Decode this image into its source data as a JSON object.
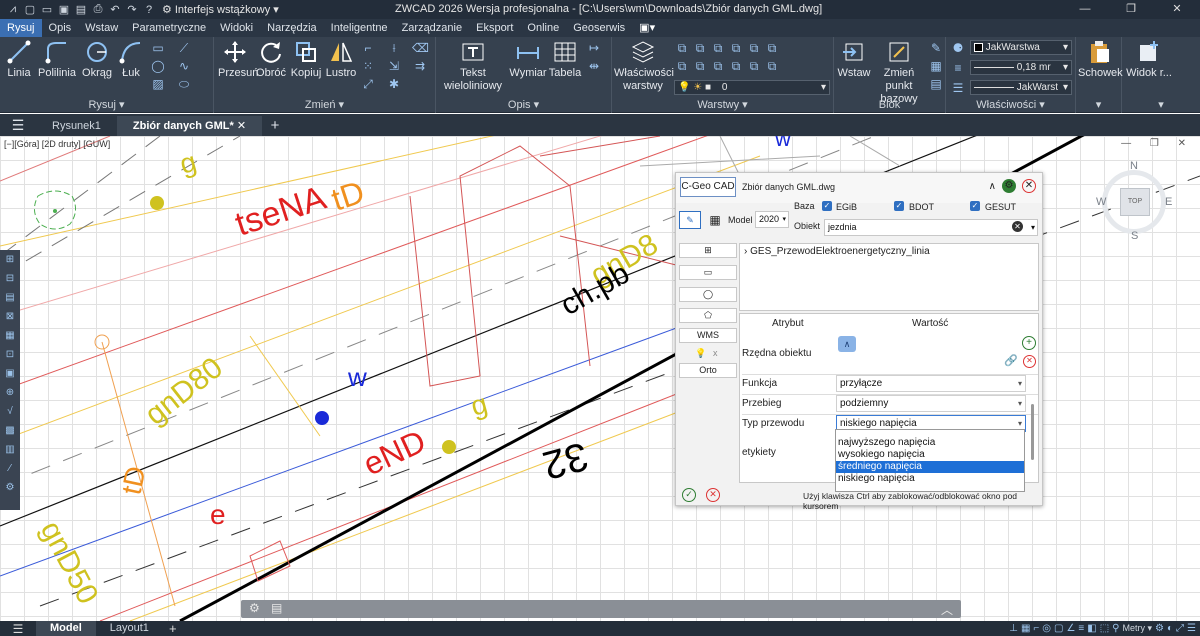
{
  "titlebar": {
    "workspace": "Interfejs wstążkowy",
    "title": "ZWCAD 2026 Wersja profesjonalna - [C:\\Users\\wm\\Downloads\\Zbiór danych GML.dwg]"
  },
  "menu": [
    "Rysuj",
    "Opis",
    "Wstaw",
    "Parametryczne",
    "Widoki",
    "Narzędzia",
    "Inteligentne",
    "Zarządzanie",
    "Eksport",
    "Online",
    "Geoserwis"
  ],
  "ribbon": {
    "rysuj": {
      "title": "Rysuj",
      "linia": "Linia",
      "polilinia": "Polilinia",
      "okrag": "Okrąg",
      "luk": "Łuk"
    },
    "zmien": {
      "title": "Zmień",
      "przesun": "Przesuń",
      "obroc": "Obróć",
      "kopiuj": "Kopiuj",
      "lustro": "Lustro"
    },
    "opis": {
      "title": "Opis",
      "tekst": "Tekst wieloliniowy",
      "wymiar": "Wymiar",
      "tabela": "Tabela"
    },
    "warstwy": {
      "title": "Warstwy",
      "wlasciwosci": "Właściwości warstwy",
      "current_layer": "0"
    },
    "blok": {
      "title": "Blok",
      "wstaw": "Wstaw",
      "zmien_punkt": "Zmień punkt bazowy"
    },
    "wlasciwosci": {
      "title": "Właściwości",
      "color": "JakWarstwa",
      "lineweight": "0,18",
      "lineweight_unit": "mr",
      "linetype": "JakWarst"
    },
    "schowek": {
      "label": "Schowek"
    },
    "widok": {
      "label": "Widok r..."
    }
  },
  "doctabs": [
    "Rysunek1",
    "Zbiór danych GML*"
  ],
  "viewport_label": "[−][Góra] [2D druty] [GUW]",
  "compass": {
    "n": "N",
    "s": "S",
    "w": "W",
    "e": "E",
    "top": "TOP"
  },
  "drawing_labels": {
    "g1": "g",
    "tseNA": "tseNA",
    "tD1": "tD",
    "w1": "w",
    "gnD80a": "gnD8",
    "chpb": "ch.pb",
    "gnD80b": "gnD80",
    "w2": "w",
    "eND": "eND",
    "g2": "g",
    "n32": "32",
    "tD2": "tD",
    "e": "e",
    "gnD50": "gnD50"
  },
  "geo_panel": {
    "tab": "C-Geo CAD",
    "file": "Zbiór danych GML.dwg",
    "model_label": "Model",
    "model_value": "2020",
    "baza_label": "Baza",
    "baza": [
      "EGiB",
      "BDOT",
      "GESUT"
    ],
    "obiekt_label": "Obiekt",
    "obiekt_value": "jezdnia",
    "tree_item": "GES_PrzewodElektroenergetyczny_linia",
    "side_buttons": [
      "WMS",
      "Orto"
    ],
    "col_atrybut": "Atrybut",
    "col_wartosc": "Wartość",
    "rows": [
      {
        "key": "Rzędna obiektu",
        "value": ""
      },
      {
        "key": "Funkcja",
        "value": "przyłącze"
      },
      {
        "key": "Przebieg",
        "value": "podziemny"
      },
      {
        "key": "Typ przewodu",
        "value": "niskiego napięcia"
      },
      {
        "key": "etykiety",
        "value": ""
      }
    ],
    "dropdown_options": [
      "najwyższego napięcia",
      "wysokiego napięcia",
      "średniego napięcia",
      "niskiego napięcia"
    ],
    "dropdown_selected": 2,
    "footer": "Użyj klawisza Ctrl aby zablokować/odblokować okno pod kursorem"
  },
  "status": {
    "tabs": [
      "Model",
      "Layout1"
    ],
    "units": "Metry"
  }
}
